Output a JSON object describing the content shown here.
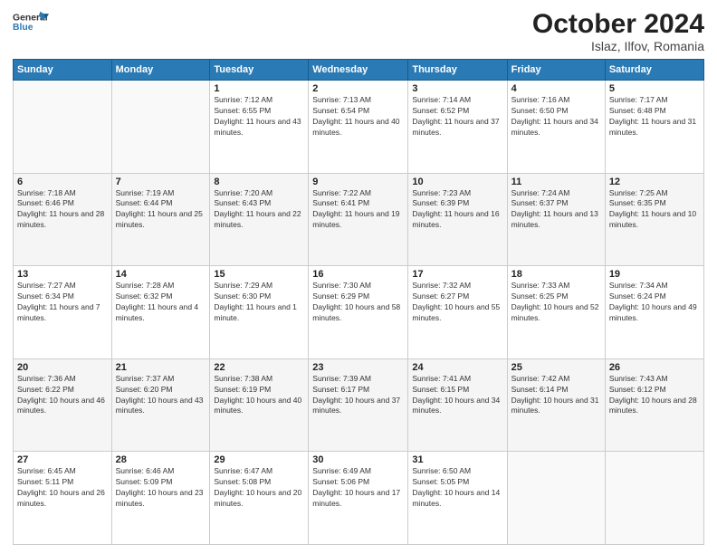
{
  "logo": {
    "line1": "General",
    "line2": "Blue"
  },
  "title": "October 2024",
  "subtitle": "Islaz, Ilfov, Romania",
  "days_of_week": [
    "Sunday",
    "Monday",
    "Tuesday",
    "Wednesday",
    "Thursday",
    "Friday",
    "Saturday"
  ],
  "weeks": [
    [
      {
        "day": "",
        "sunrise": "",
        "sunset": "",
        "daylight": ""
      },
      {
        "day": "",
        "sunrise": "",
        "sunset": "",
        "daylight": ""
      },
      {
        "day": "1",
        "sunrise": "Sunrise: 7:12 AM",
        "sunset": "Sunset: 6:55 PM",
        "daylight": "Daylight: 11 hours and 43 minutes."
      },
      {
        "day": "2",
        "sunrise": "Sunrise: 7:13 AM",
        "sunset": "Sunset: 6:54 PM",
        "daylight": "Daylight: 11 hours and 40 minutes."
      },
      {
        "day": "3",
        "sunrise": "Sunrise: 7:14 AM",
        "sunset": "Sunset: 6:52 PM",
        "daylight": "Daylight: 11 hours and 37 minutes."
      },
      {
        "day": "4",
        "sunrise": "Sunrise: 7:16 AM",
        "sunset": "Sunset: 6:50 PM",
        "daylight": "Daylight: 11 hours and 34 minutes."
      },
      {
        "day": "5",
        "sunrise": "Sunrise: 7:17 AM",
        "sunset": "Sunset: 6:48 PM",
        "daylight": "Daylight: 11 hours and 31 minutes."
      }
    ],
    [
      {
        "day": "6",
        "sunrise": "Sunrise: 7:18 AM",
        "sunset": "Sunset: 6:46 PM",
        "daylight": "Daylight: 11 hours and 28 minutes."
      },
      {
        "day": "7",
        "sunrise": "Sunrise: 7:19 AM",
        "sunset": "Sunset: 6:44 PM",
        "daylight": "Daylight: 11 hours and 25 minutes."
      },
      {
        "day": "8",
        "sunrise": "Sunrise: 7:20 AM",
        "sunset": "Sunset: 6:43 PM",
        "daylight": "Daylight: 11 hours and 22 minutes."
      },
      {
        "day": "9",
        "sunrise": "Sunrise: 7:22 AM",
        "sunset": "Sunset: 6:41 PM",
        "daylight": "Daylight: 11 hours and 19 minutes."
      },
      {
        "day": "10",
        "sunrise": "Sunrise: 7:23 AM",
        "sunset": "Sunset: 6:39 PM",
        "daylight": "Daylight: 11 hours and 16 minutes."
      },
      {
        "day": "11",
        "sunrise": "Sunrise: 7:24 AM",
        "sunset": "Sunset: 6:37 PM",
        "daylight": "Daylight: 11 hours and 13 minutes."
      },
      {
        "day": "12",
        "sunrise": "Sunrise: 7:25 AM",
        "sunset": "Sunset: 6:35 PM",
        "daylight": "Daylight: 11 hours and 10 minutes."
      }
    ],
    [
      {
        "day": "13",
        "sunrise": "Sunrise: 7:27 AM",
        "sunset": "Sunset: 6:34 PM",
        "daylight": "Daylight: 11 hours and 7 minutes."
      },
      {
        "day": "14",
        "sunrise": "Sunrise: 7:28 AM",
        "sunset": "Sunset: 6:32 PM",
        "daylight": "Daylight: 11 hours and 4 minutes."
      },
      {
        "day": "15",
        "sunrise": "Sunrise: 7:29 AM",
        "sunset": "Sunset: 6:30 PM",
        "daylight": "Daylight: 11 hours and 1 minute."
      },
      {
        "day": "16",
        "sunrise": "Sunrise: 7:30 AM",
        "sunset": "Sunset: 6:29 PM",
        "daylight": "Daylight: 10 hours and 58 minutes."
      },
      {
        "day": "17",
        "sunrise": "Sunrise: 7:32 AM",
        "sunset": "Sunset: 6:27 PM",
        "daylight": "Daylight: 10 hours and 55 minutes."
      },
      {
        "day": "18",
        "sunrise": "Sunrise: 7:33 AM",
        "sunset": "Sunset: 6:25 PM",
        "daylight": "Daylight: 10 hours and 52 minutes."
      },
      {
        "day": "19",
        "sunrise": "Sunrise: 7:34 AM",
        "sunset": "Sunset: 6:24 PM",
        "daylight": "Daylight: 10 hours and 49 minutes."
      }
    ],
    [
      {
        "day": "20",
        "sunrise": "Sunrise: 7:36 AM",
        "sunset": "Sunset: 6:22 PM",
        "daylight": "Daylight: 10 hours and 46 minutes."
      },
      {
        "day": "21",
        "sunrise": "Sunrise: 7:37 AM",
        "sunset": "Sunset: 6:20 PM",
        "daylight": "Daylight: 10 hours and 43 minutes."
      },
      {
        "day": "22",
        "sunrise": "Sunrise: 7:38 AM",
        "sunset": "Sunset: 6:19 PM",
        "daylight": "Daylight: 10 hours and 40 minutes."
      },
      {
        "day": "23",
        "sunrise": "Sunrise: 7:39 AM",
        "sunset": "Sunset: 6:17 PM",
        "daylight": "Daylight: 10 hours and 37 minutes."
      },
      {
        "day": "24",
        "sunrise": "Sunrise: 7:41 AM",
        "sunset": "Sunset: 6:15 PM",
        "daylight": "Daylight: 10 hours and 34 minutes."
      },
      {
        "day": "25",
        "sunrise": "Sunrise: 7:42 AM",
        "sunset": "Sunset: 6:14 PM",
        "daylight": "Daylight: 10 hours and 31 minutes."
      },
      {
        "day": "26",
        "sunrise": "Sunrise: 7:43 AM",
        "sunset": "Sunset: 6:12 PM",
        "daylight": "Daylight: 10 hours and 28 minutes."
      }
    ],
    [
      {
        "day": "27",
        "sunrise": "Sunrise: 6:45 AM",
        "sunset": "Sunset: 5:11 PM",
        "daylight": "Daylight: 10 hours and 26 minutes."
      },
      {
        "day": "28",
        "sunrise": "Sunrise: 6:46 AM",
        "sunset": "Sunset: 5:09 PM",
        "daylight": "Daylight: 10 hours and 23 minutes."
      },
      {
        "day": "29",
        "sunrise": "Sunrise: 6:47 AM",
        "sunset": "Sunset: 5:08 PM",
        "daylight": "Daylight: 10 hours and 20 minutes."
      },
      {
        "day": "30",
        "sunrise": "Sunrise: 6:49 AM",
        "sunset": "Sunset: 5:06 PM",
        "daylight": "Daylight: 10 hours and 17 minutes."
      },
      {
        "day": "31",
        "sunrise": "Sunrise: 6:50 AM",
        "sunset": "Sunset: 5:05 PM",
        "daylight": "Daylight: 10 hours and 14 minutes."
      },
      {
        "day": "",
        "sunrise": "",
        "sunset": "",
        "daylight": ""
      },
      {
        "day": "",
        "sunrise": "",
        "sunset": "",
        "daylight": ""
      }
    ]
  ]
}
